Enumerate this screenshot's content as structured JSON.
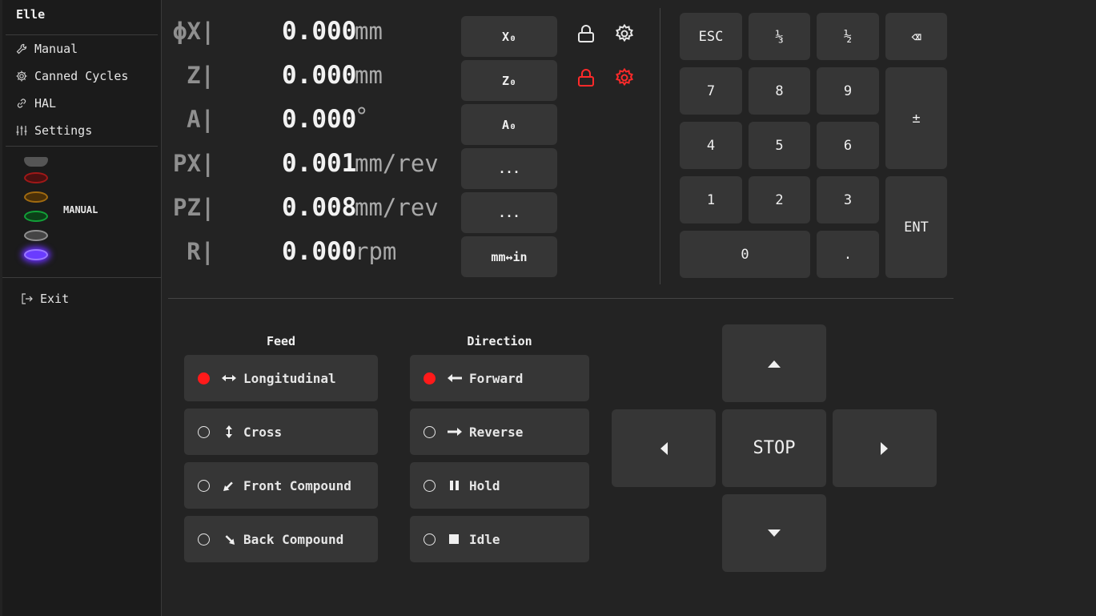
{
  "app_title": "Elle",
  "sidebar": {
    "items": [
      {
        "label": "Manual",
        "icon": "wrench-icon"
      },
      {
        "label": "Canned Cycles",
        "icon": "gear-icon"
      },
      {
        "label": "HAL",
        "icon": "link-icon"
      },
      {
        "label": "Settings",
        "icon": "sliders-icon"
      }
    ],
    "leds": [
      {
        "color": "#5a5a5a",
        "state": "off"
      },
      {
        "color": "#c02020",
        "state": "dim"
      },
      {
        "color": "#c08010",
        "state": "dim"
      },
      {
        "color": "#10a030",
        "state": "dim"
      },
      {
        "color": "#8a8a8a",
        "state": "dim"
      },
      {
        "color": "#7a3cff",
        "state": "on"
      }
    ],
    "mode": "MANUAL",
    "exit_label": "Exit"
  },
  "dro": {
    "rows": [
      {
        "axis": "ϕX|",
        "value": "0.000",
        "unit": "mm",
        "button": "X₀"
      },
      {
        "axis": "Z|",
        "value": "0.000",
        "unit": "mm",
        "button": "Z₀"
      },
      {
        "axis": "A|",
        "value": "0.000",
        "unit": "°",
        "button": "A₀"
      },
      {
        "axis": "PX|",
        "value": "0.001",
        "unit": "mm/rev",
        "button": "..."
      },
      {
        "axis": "PZ|",
        "value": "0.008",
        "unit": "mm/rev",
        "button": "..."
      },
      {
        "axis": "R|",
        "value": "0.000",
        "unit": "rpm",
        "button": "mm↔in"
      }
    ],
    "lock_colors": {
      "x": "#e6e6e6",
      "z": "#ff2a2a"
    }
  },
  "keypad": {
    "esc": "ESC",
    "third": "⅓",
    "half": "½",
    "backspace": "⌫",
    "k7": "7",
    "k8": "8",
    "k9": "9",
    "plusminus": "±",
    "k4": "4",
    "k5": "5",
    "k6": "6",
    "k1": "1",
    "k2": "2",
    "k3": "3",
    "enter": "ENT",
    "k0": "0",
    "dot": "."
  },
  "feed": {
    "title": "Feed",
    "options": [
      {
        "label": "Longitudinal",
        "selected": true
      },
      {
        "label": "Cross",
        "selected": false
      },
      {
        "label": "Front Compound",
        "selected": false
      },
      {
        "label": "Back Compound",
        "selected": false
      }
    ]
  },
  "direction": {
    "title": "Direction",
    "options": [
      {
        "label": "Forward",
        "selected": true
      },
      {
        "label": "Reverse",
        "selected": false
      },
      {
        "label": "Hold",
        "selected": false
      },
      {
        "label": "Idle",
        "selected": false
      }
    ]
  },
  "jog": {
    "stop": "STOP"
  }
}
